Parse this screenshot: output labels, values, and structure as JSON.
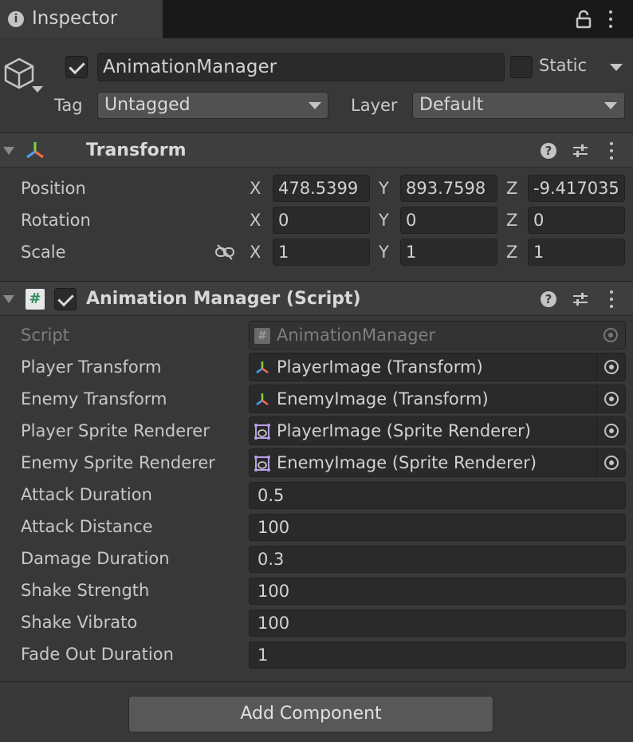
{
  "tab": {
    "title": "Inspector",
    "info_icon": "info-icon",
    "lock_icon": "lock-icon",
    "menu_icon": "kebab-menu-icon"
  },
  "gameobject": {
    "icon": "cube-icon",
    "active": true,
    "name": "AnimationManager",
    "static_label": "Static",
    "static_checked": false,
    "tag_label": "Tag",
    "tag_value": "Untagged",
    "layer_label": "Layer",
    "layer_value": "Default"
  },
  "transform": {
    "title": "Transform",
    "icon": "transform-icon",
    "rows": [
      {
        "label": "Position",
        "x": "478.5399",
        "y": "893.7598",
        "z": "-9.417035"
      },
      {
        "label": "Rotation",
        "x": "0",
        "y": "0",
        "z": "0"
      },
      {
        "label": "Scale",
        "x": "1",
        "y": "1",
        "z": "1"
      }
    ],
    "axis": {
      "x": "X",
      "y": "Y",
      "z": "Z"
    }
  },
  "script_component": {
    "title": "Animation Manager (Script)",
    "icon": "csharp-script-icon",
    "enabled": true,
    "script_label": "Script",
    "script_value": "AnimationManager",
    "object_fields": [
      {
        "label": "Player Transform",
        "value": "PlayerImage (Transform)",
        "icon": "transform-icon"
      },
      {
        "label": "Enemy Transform",
        "value": "EnemyImage (Transform)",
        "icon": "transform-icon"
      },
      {
        "label": "Player Sprite Renderer",
        "value": "PlayerImage (Sprite Renderer)",
        "icon": "sprite-renderer-icon"
      },
      {
        "label": "Enemy Sprite Renderer",
        "value": "EnemyImage (Sprite Renderer)",
        "icon": "sprite-renderer-icon"
      }
    ],
    "value_fields": [
      {
        "label": "Attack Duration",
        "value": "0.5"
      },
      {
        "label": "Attack Distance",
        "value": "100"
      },
      {
        "label": "Damage Duration",
        "value": "0.3"
      },
      {
        "label": "Shake Strength",
        "value": "100"
      },
      {
        "label": "Shake Vibrato",
        "value": "100"
      },
      {
        "label": "Fade Out Duration",
        "value": "1"
      }
    ]
  },
  "add_component_label": "Add Component",
  "colors": {
    "background": "#383838",
    "tabbar": "#191919",
    "field": "#2a2a2a",
    "header": "#3e3e3e",
    "button": "#585858"
  }
}
